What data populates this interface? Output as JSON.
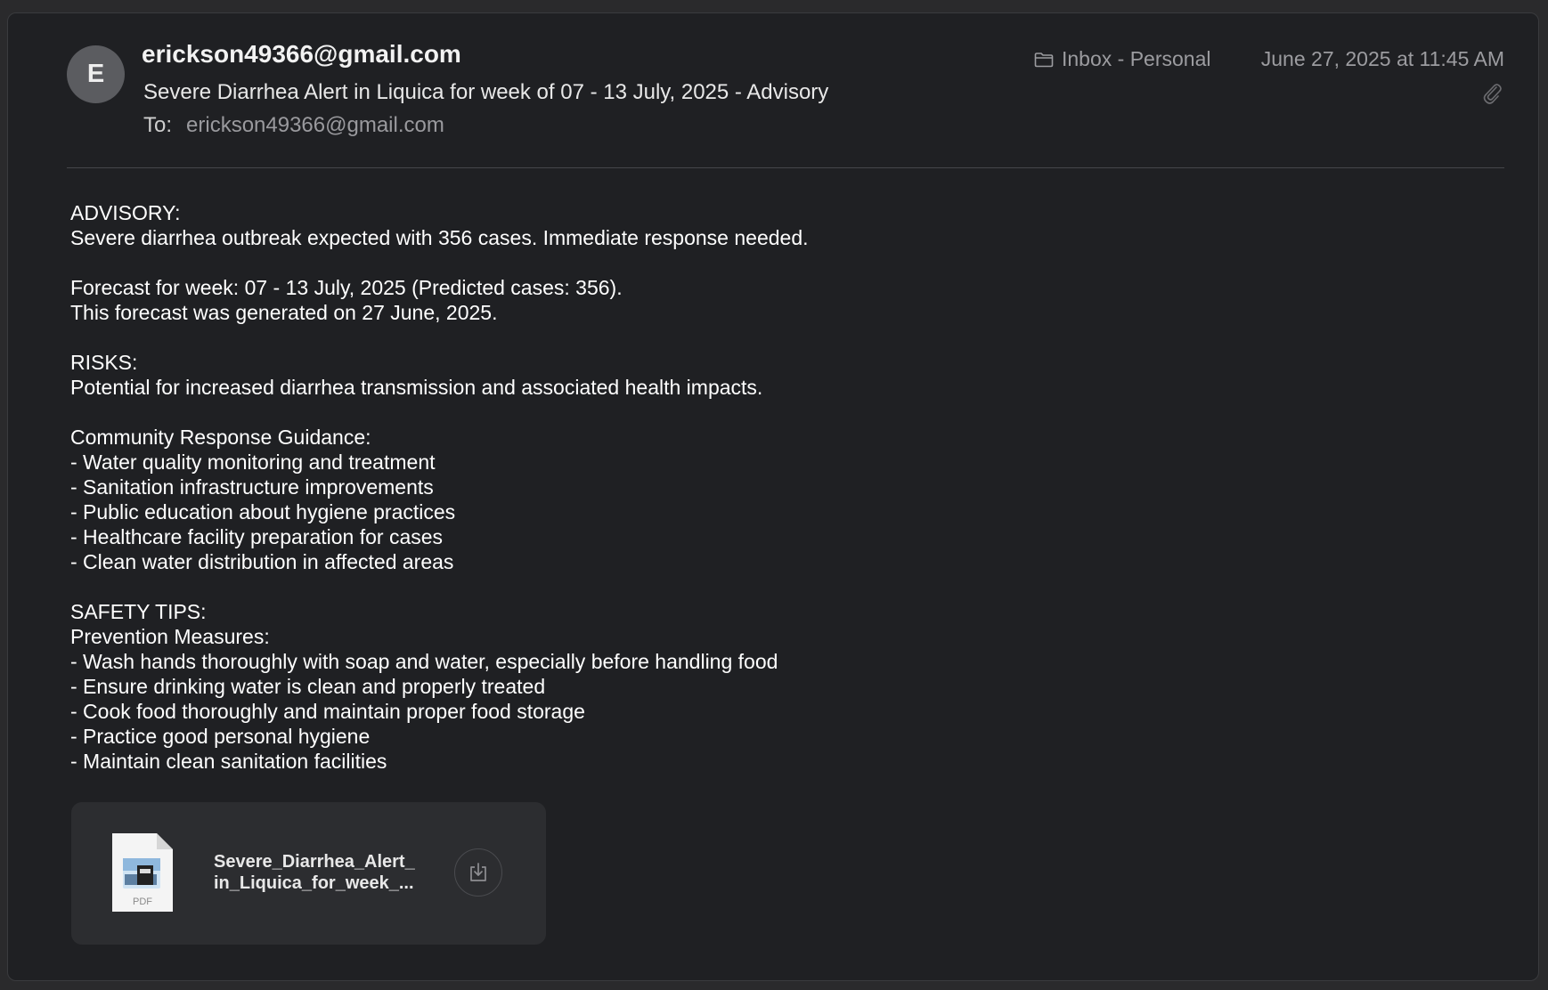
{
  "header": {
    "avatar_initial": "E",
    "sender": "erickson49366@gmail.com",
    "subject": "Severe Diarrhea Alert in Liquica for week of 07 - 13 July, 2025 - Advisory",
    "to_label": "To:",
    "to_address": "erickson49366@gmail.com",
    "mailbox": "Inbox - Personal",
    "date": "June 27, 2025 at 11:45 AM"
  },
  "body": {
    "lines": [
      "ADVISORY:",
      "Severe diarrhea outbreak expected with 356 cases. Immediate response needed.",
      "",
      "Forecast for week: 07 - 13 July, 2025 (Predicted cases: 356).",
      "This forecast was generated on 27 June, 2025.",
      "",
      "RISKS:",
      "Potential for increased diarrhea transmission and associated health impacts.",
      "",
      "Community Response Guidance:",
      "- Water quality monitoring and treatment",
      "- Sanitation infrastructure improvements",
      "- Public education about hygiene practices",
      "- Healthcare facility preparation for cases",
      "- Clean water distribution in affected areas",
      "",
      "SAFETY TIPS:",
      "Prevention Measures:",
      "- Wash hands thoroughly with soap and water, especially before handling food",
      "- Ensure drinking water is clean and properly treated",
      "- Cook food thoroughly and maintain proper food storage",
      "- Practice good personal hygiene",
      "- Maintain clean sanitation facilities"
    ]
  },
  "attachment": {
    "file_type": "PDF",
    "name_line1": "Severe_Diarrhea_Alert_",
    "name_line2": "in_Liquica_for_week_..."
  },
  "icons": {
    "folder": "folder-icon",
    "paperclip": "paperclip-icon",
    "pdf": "pdf-file-icon",
    "download": "download-icon"
  },
  "colors": {
    "window_bg": "#1f2023",
    "attachment_bg": "#2c2d30",
    "muted_text": "#9c9ca0",
    "avatar_bg": "#5b5c60"
  }
}
